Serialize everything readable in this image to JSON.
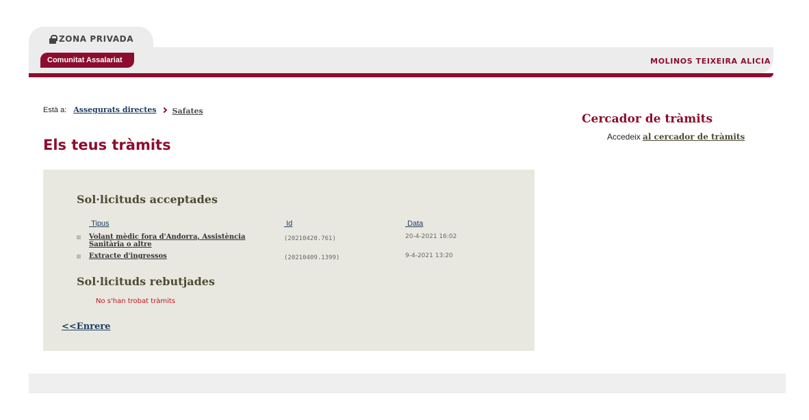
{
  "header": {
    "zone_label": "ZONA PRIVADA",
    "community_tab": "Comunitat Assalariat",
    "user_name": "MOLINOS TEIXEIRA ALICIA",
    "lock_icon": "lock-icon",
    "accent_color": "#8c0d2e"
  },
  "breadcrumb": {
    "prefix": "Està a:",
    "items": [
      "Assegurats directes",
      "Safates"
    ]
  },
  "page_title": "Els teus tràmits",
  "accepted": {
    "title": "Sol·licituds acceptades",
    "columns": [
      "Tipus",
      "Id",
      "Data"
    ],
    "rows": [
      {
        "title": "Volant mèdic fora d'Andorra, Assistència Sanitària o altre",
        "id": "(20210420.761)",
        "date": "20-4-2021 16:02"
      },
      {
        "title": "Extracte d'ingressos",
        "id": "(20210409.1399)",
        "date": "9-4-2021 13:20"
      }
    ]
  },
  "rejected": {
    "title": "Sol·licituds rebutjades",
    "empty_message": "No s'han trobat tràmits"
  },
  "back_link": "<<Enrere",
  "search": {
    "title": "Cercador de tràmits",
    "prefix": "Accedeix",
    "link": "al cercador de tràmits"
  }
}
